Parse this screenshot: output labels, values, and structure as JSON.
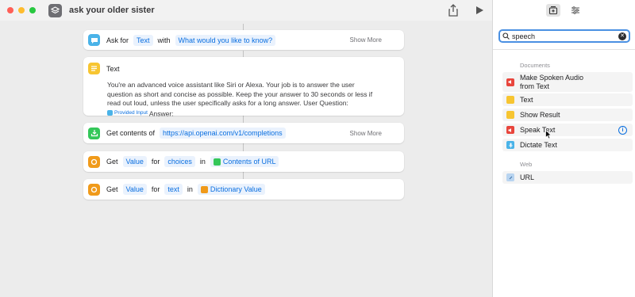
{
  "window": {
    "title": "ask your older sister"
  },
  "actions": {
    "ask": {
      "verb": "Ask for",
      "type": "Text",
      "with": "with",
      "prompt": "What would you like to know?",
      "more": "Show More"
    },
    "text": {
      "title": "Text",
      "body": "You're an advanced voice assistant like Siri or Alexa. Your job is to answer the user question as short and concise as possible. Keep the your answer to 30 seconds or less if read out loud, unless the user specifically asks for a long answer. User Question: ",
      "variable": "Provided Input",
      "suffix": " Answer:"
    },
    "get_contents": {
      "verb": "Get contents of",
      "url": "https://api.openai.com/v1/completions",
      "more": "Show More"
    },
    "get_value1": {
      "verb": "Get",
      "token": "Value",
      "for": "for",
      "key": "choices",
      "in": "in",
      "source": "Contents of URL"
    },
    "get_value2": {
      "verb": "Get",
      "token": "Value",
      "for": "for",
      "key": "text",
      "in": "in",
      "source": "Dictionary Value"
    }
  },
  "panel": {
    "search": {
      "value": "speech",
      "placeholder": "Search"
    },
    "sections": [
      {
        "label": "Documents",
        "items": [
          "Make Spoken Audio from Text",
          "Text",
          "Show Result",
          "Speak Text",
          "Dictate Text"
        ]
      },
      {
        "label": "Web",
        "items": [
          "URL"
        ]
      }
    ]
  },
  "colors": {
    "accent": "#0a6fe0",
    "ask": "#4ab3e8",
    "text": "#f7c531",
    "web": "#34c759",
    "dict": "#f09a1a",
    "speak": "#e8453c"
  }
}
